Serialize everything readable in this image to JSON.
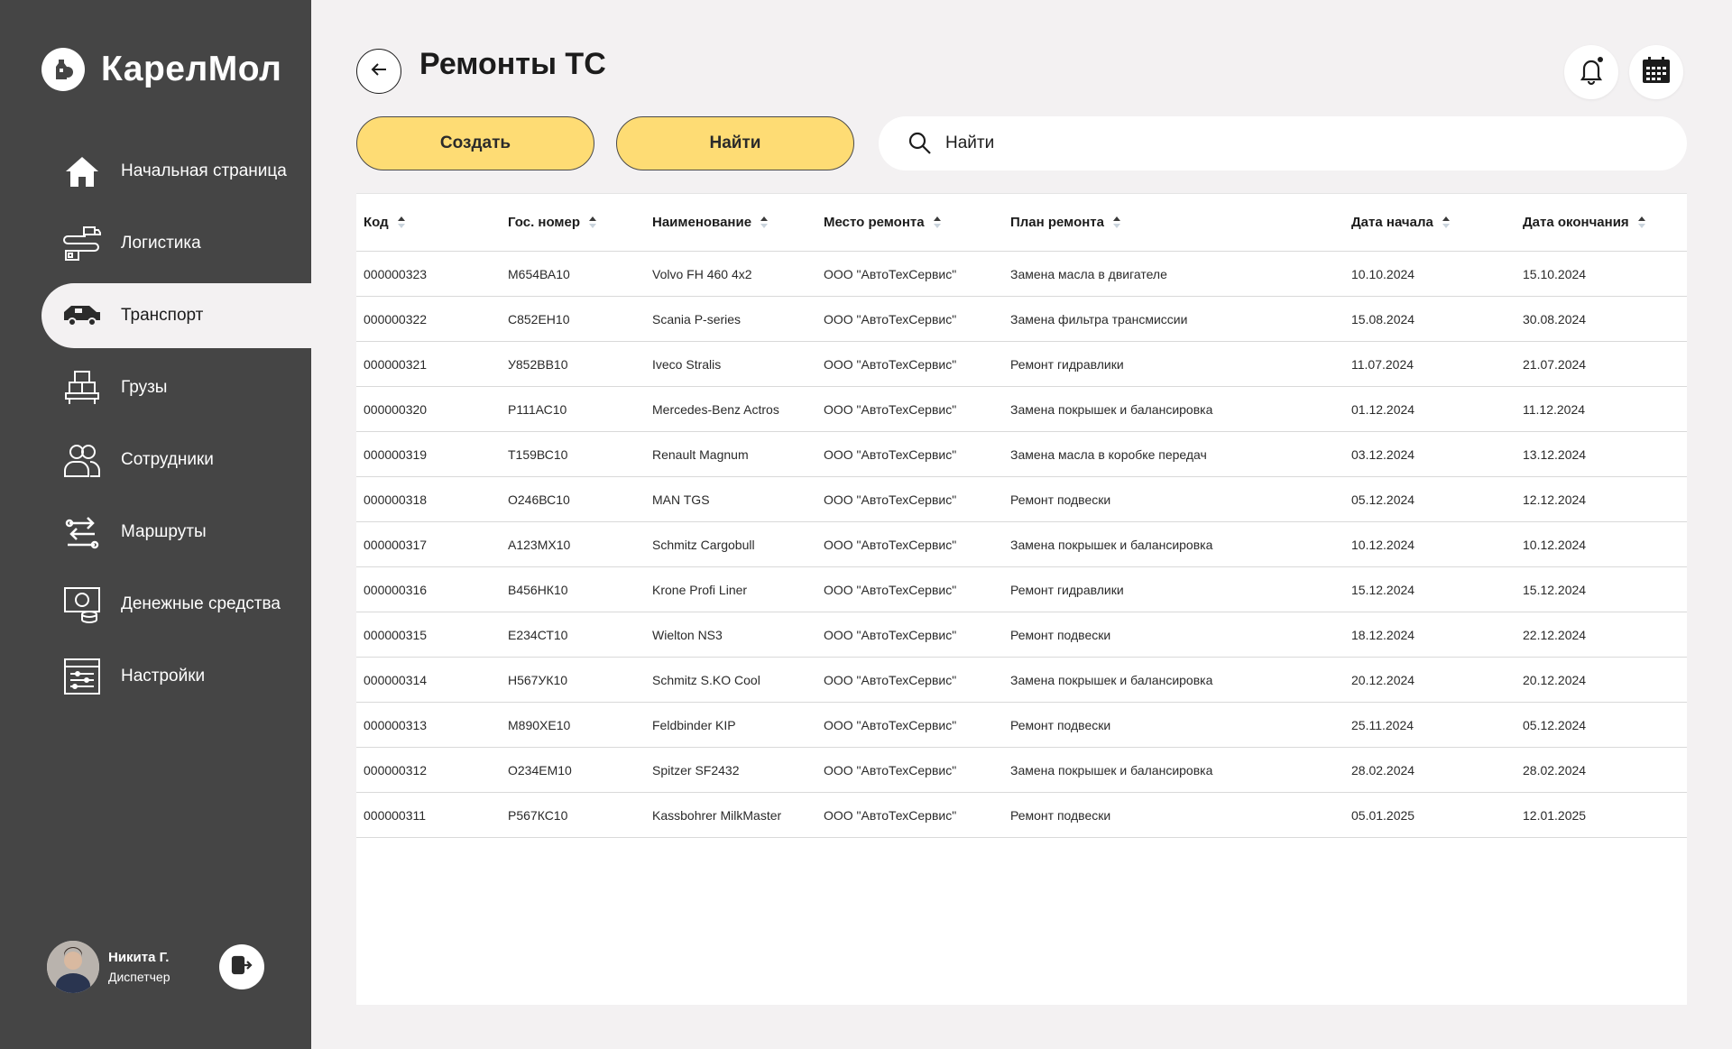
{
  "brand": {
    "name": "КарелМол",
    "logo_icon": "milk-bottle-logo-icon"
  },
  "sidebar": {
    "items": [
      {
        "label": "Начальная страница",
        "icon": "home-icon"
      },
      {
        "label": "Логистика",
        "icon": "logistics-icon"
      },
      {
        "label": "Транспорт",
        "icon": "truck-icon",
        "active": true
      },
      {
        "label": "Грузы",
        "icon": "cargo-icon"
      },
      {
        "label": "Сотрудники",
        "icon": "employees-icon"
      },
      {
        "label": "Маршруты",
        "icon": "routes-icon"
      },
      {
        "label": "Денежные средства",
        "icon": "money-icon"
      },
      {
        "label": "Настройки",
        "icon": "settings-icon"
      }
    ]
  },
  "user": {
    "name": "Никита Г.",
    "role": "Диспетчер"
  },
  "header": {
    "title": "Ремонты ТС"
  },
  "toolbar": {
    "create_label": "Создать",
    "find_label": "Найти",
    "search_placeholder": "Найти"
  },
  "table": {
    "columns": [
      "Код",
      "Гос. номер",
      "Наименование",
      "Место ремонта",
      "План ремонта",
      "Дата начала",
      "Дата окончания"
    ],
    "rows": [
      [
        "000000323",
        "М654ВА10",
        "Volvo FH 460 4x2",
        "ООО \"АвтоТехСервис\"",
        "Замена масла в двигателе",
        "10.10.2024",
        "15.10.2024"
      ],
      [
        "000000322",
        "С852ЕН10",
        "Scania P-series",
        "ООО \"АвтоТехСервис\"",
        "Замена фильтра трансмиссии",
        "15.08.2024",
        "30.08.2024"
      ],
      [
        "000000321",
        "У852ВВ10",
        "Iveco Stralis",
        "ООО \"АвтоТехСервис\"",
        "Ремонт гидравлики",
        "11.07.2024",
        "21.07.2024"
      ],
      [
        "000000320",
        "Р111АС10",
        "Mercedes-Benz Actros",
        "ООО \"АвтоТехСервис\"",
        "Замена покрышек и балансировка",
        "01.12.2024",
        "11.12.2024"
      ],
      [
        "000000319",
        "Т159ВС10",
        "Renault Magnum",
        "ООО \"АвтоТехСервис\"",
        "Замена масла в коробке передач",
        "03.12.2024",
        "13.12.2024"
      ],
      [
        "000000318",
        "О246ВС10",
        "MAN TGS",
        "ООО \"АвтоТехСервис\"",
        "Ремонт подвески",
        "05.12.2024",
        "12.12.2024"
      ],
      [
        "000000317",
        "А123МХ10",
        "Schmitz Cargobull",
        "ООО \"АвтоТехСервис\"",
        "Замена покрышек и балансировка",
        "10.12.2024",
        "10.12.2024"
      ],
      [
        "000000316",
        "В456НК10",
        "Krone Profi Liner",
        "ООО \"АвтоТехСервис\"",
        "Ремонт гидравлики",
        "15.12.2024",
        "15.12.2024"
      ],
      [
        "000000315",
        "Е234СТ10",
        "Wielton NS3",
        "ООО \"АвтоТехСервис\"",
        "Ремонт подвески",
        "18.12.2024",
        "22.12.2024"
      ],
      [
        "000000314",
        "Н567УК10",
        "Schmitz S.KO Cool",
        "ООО \"АвтоТехСервис\"",
        "Замена покрышек и балансировка",
        "20.12.2024",
        "20.12.2024"
      ],
      [
        "000000313",
        "М890ХЕ10",
        "Feldbinder KIP",
        "ООО \"АвтоТехСервис\"",
        "Ремонт подвески",
        "25.11.2024",
        "05.12.2024"
      ],
      [
        "000000312",
        "О234ЕМ10",
        "Spitzer SF2432",
        "ООО \"АвтоТехСервис\"",
        "Замена покрышек и балансировка",
        "28.02.2024",
        "28.02.2024"
      ],
      [
        "000000311",
        "Р567КС10",
        "Kassbohrer MilkMaster",
        "ООО \"АвтоТехСервис\"",
        "Ремонт подвески",
        "05.01.2025",
        "12.01.2025"
      ]
    ]
  },
  "colors": {
    "sidebar_bg": "#454545",
    "page_bg": "#f3f1f2",
    "accent_yellow": "#fedc74",
    "text_dark": "#1c1c1c"
  }
}
